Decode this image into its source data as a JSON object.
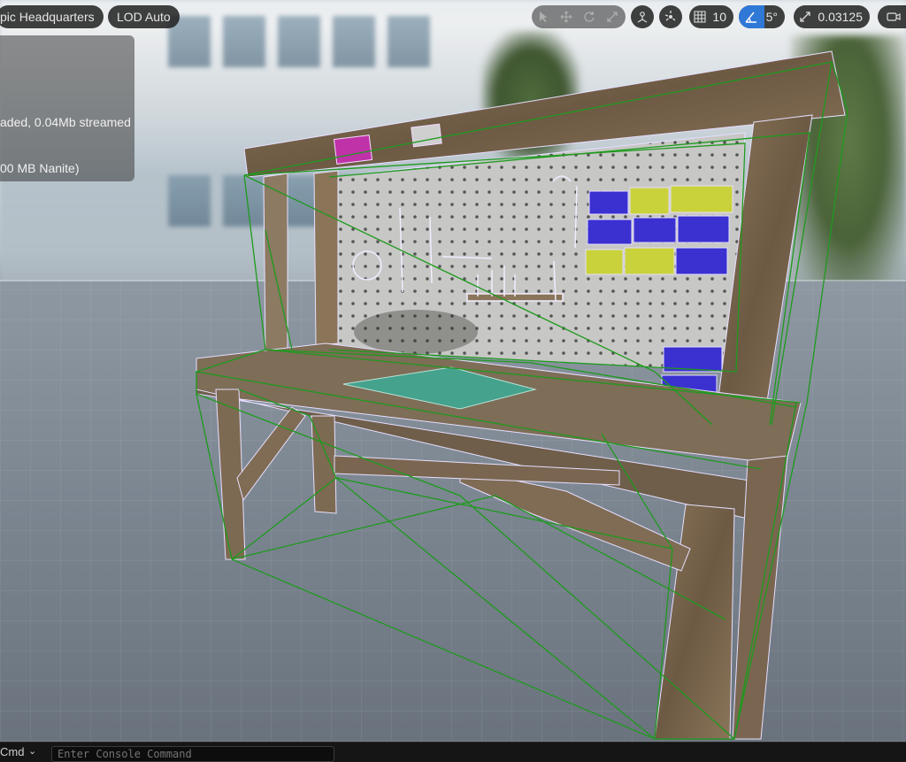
{
  "toolbar": {
    "view_mode_label": "pic Headquarters",
    "lod_label": "LOD Auto",
    "grid_snap_value": "10",
    "rotation_snap_value": "5°",
    "scale_snap_value": "0.03125"
  },
  "stats_overlay": {
    "line1": "aded, 0.04Mb streamed",
    "line2": "00 MB Nanite)"
  },
  "bench": {
    "sign_left": "",
    "sign_right": ""
  },
  "console": {
    "cmd_label": "Cmd",
    "input_placeholder": "Enter Console Command"
  },
  "colors": {
    "accent": "#2f78d6",
    "wireframe": "#1e9a1e",
    "wood": "#7a6650",
    "bin_blue": "#3b30d0",
    "bin_yellow": "#c9d23a"
  },
  "icons": {
    "select": "select-icon",
    "translate": "translate-icon",
    "rotate": "rotate-icon",
    "scale": "scale-icon",
    "world": "world-space-icon",
    "surface_snap": "surface-snap-icon",
    "grid": "grid-icon",
    "angle": "angle-snap-icon",
    "scale_snap": "scale-snap-icon",
    "camera": "camera-icon"
  }
}
